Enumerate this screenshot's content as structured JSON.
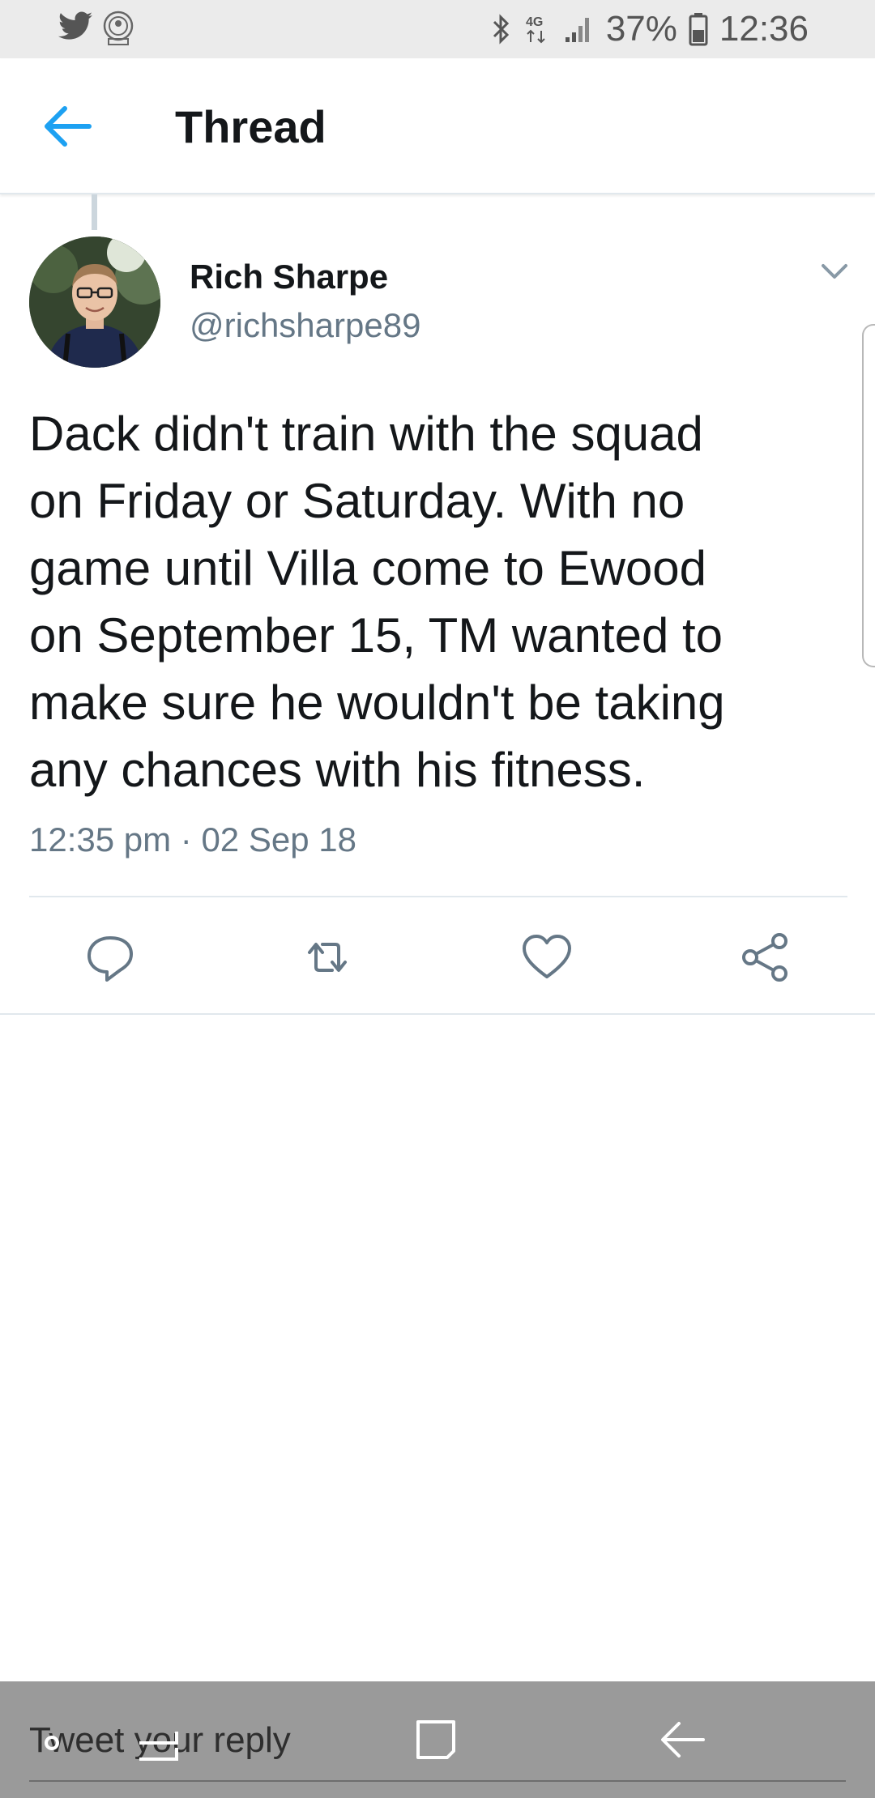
{
  "status_bar": {
    "battery": "37%",
    "time": "12:36",
    "network": "4G",
    "icons": [
      "twitter-icon",
      "badge-icon",
      "bluetooth-icon",
      "signal-icon",
      "battery-icon"
    ]
  },
  "header": {
    "title": "Thread"
  },
  "tweet": {
    "author_name": "Rich Sharpe",
    "author_handle": "@richsharpe89",
    "lines": [
      "Dack didn't train with the squad",
      "on Friday or Saturday. With no",
      "game until Villa come to Ewood",
      "on September 15, TM wanted to",
      "make sure he wouldn't be taking",
      "any chances with his fitness."
    ],
    "timestamp": "12:35 pm · 02 Sep 18"
  },
  "actions": [
    "reply-icon",
    "retweet-icon",
    "like-icon",
    "share-icon"
  ],
  "reply_bar": {
    "placeholder": "Tweet your reply"
  },
  "colors": {
    "accent": "#1da1f2",
    "secondary_text": "#657786",
    "primary_text": "#14171a"
  }
}
